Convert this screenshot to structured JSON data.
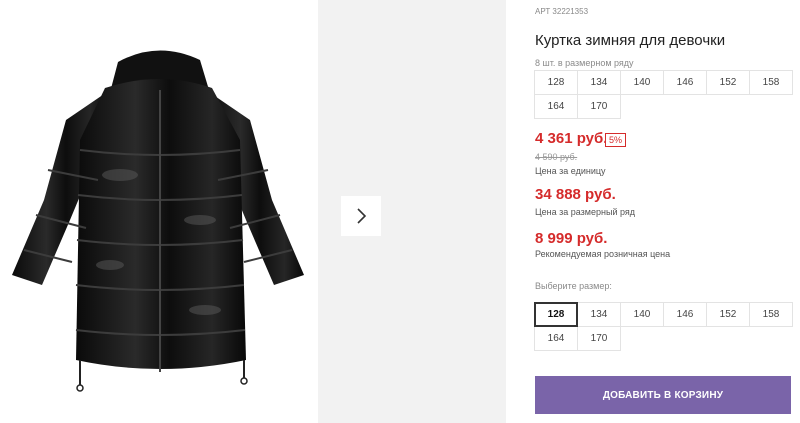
{
  "product": {
    "sku_label": "АРТ 32221353",
    "title": "Куртка зимняя для девочки",
    "image_icon": "black-puffer-jacket-image"
  },
  "series_sizes": {
    "note": "8 шт. в размерном ряду",
    "sizes": [
      "128",
      "134",
      "140",
      "146",
      "152",
      "158",
      "164",
      "170"
    ]
  },
  "pricing": {
    "unit_price": "4 361 руб.",
    "discount_badge": "5%",
    "old_price": "4 590 руб.",
    "unit_note": "Цена за единицу",
    "series_price": "34 888 руб.",
    "series_note": "Цена за размерный ряд",
    "retail_price": "8 999 руб.",
    "retail_note": "Рекомендуемая розничная цена",
    "accent_color": "#d52b2b"
  },
  "size_select": {
    "label": "Выберите размер:",
    "selected": "128",
    "sizes": [
      "128",
      "134",
      "140",
      "146",
      "152",
      "158",
      "164",
      "170"
    ]
  },
  "cart": {
    "button_label": "ДОБАВИТЬ В КОРЗИНУ",
    "button_color": "#7a64a9"
  },
  "gallery": {
    "next_icon": "chevron-right-icon"
  }
}
